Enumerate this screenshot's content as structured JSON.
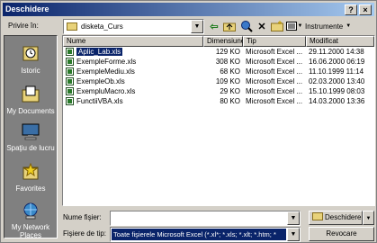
{
  "window": {
    "title": "Deschidere",
    "help_icon": "help-icon",
    "close_icon": "close-icon"
  },
  "toolbar": {
    "look_in_label": "Privire în:",
    "look_in_value": "disketa_Curs",
    "tools_label": "Instrumente"
  },
  "places": [
    {
      "label": "Istoric",
      "icon": "history-icon"
    },
    {
      "label": "My Documents",
      "icon": "my-documents-icon"
    },
    {
      "label": "Spaţiu de lucru",
      "icon": "desktop-icon"
    },
    {
      "label": "Favorites",
      "icon": "favorites-icon"
    },
    {
      "label": "My Network Places",
      "icon": "network-places-icon"
    }
  ],
  "columns": {
    "name": "Nume",
    "size": "Dimensiune",
    "type": "Tip",
    "modified": "Modificat"
  },
  "files": [
    {
      "name": "Aplic_Lab.xls",
      "size": "129 KO",
      "type": "Microsoft Excel ...",
      "modified": "29.11.2000 14:38",
      "selected": true
    },
    {
      "name": "ExempleForme.xls",
      "size": "308 KO",
      "type": "Microsoft Excel ...",
      "modified": "16.06.2000 06:19"
    },
    {
      "name": "ExempleMediu.xls",
      "size": "68 KO",
      "type": "Microsoft Excel ...",
      "modified": "11.10.1999 11:14"
    },
    {
      "name": "ExempleOb.xls",
      "size": "109 KO",
      "type": "Microsoft Excel ...",
      "modified": "02.03.2000 13:40"
    },
    {
      "name": "ExempluMacro.xls",
      "size": "29 KO",
      "type": "Microsoft Excel ...",
      "modified": "15.10.1999 08:03"
    },
    {
      "name": "FunctiiVBA.xls",
      "size": "80 KO",
      "type": "Microsoft Excel ...",
      "modified": "14.03.2000 13:36"
    }
  ],
  "footer": {
    "filename_label": "Nume fişier:",
    "filename_value": "",
    "filetype_label": "Fişiere de tip:",
    "filetype_value": "Toate fişierele Microsoft Excel (*.xl*; *.xls; *.xlt; *.htm; *",
    "open_button": "Deschidere",
    "cancel_button": "Revocare"
  }
}
